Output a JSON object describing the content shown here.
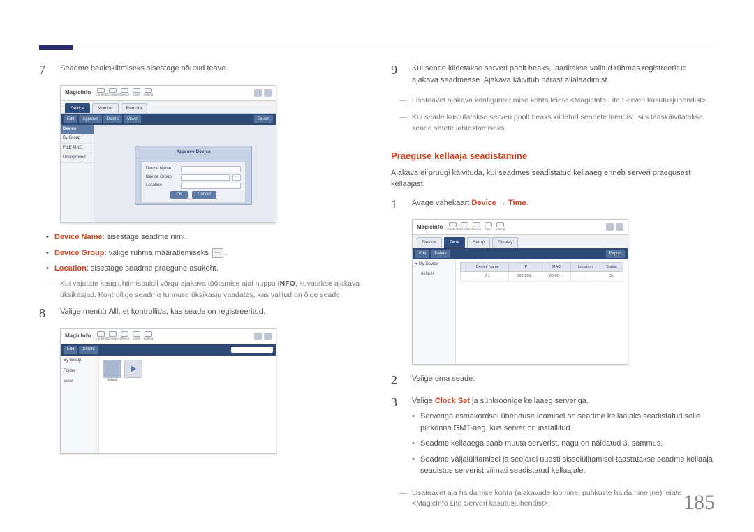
{
  "page_number": "185",
  "left": {
    "step7": {
      "num": "7",
      "text": "Seadme heakskiitmiseks sisestage nõutud teave.",
      "bullet1_label": "Device Name",
      "bullet1_text": ": sisestage seadme nimi.",
      "bullet2_label": "Device Group",
      "bullet2_text": ": valige rühma määratlemiseks",
      "bullet2_after": ".",
      "bullet3_label": "Location",
      "bullet3_text": ": sisestage seadme praegune asukoht.",
      "dash1_a": "Kui vajutate kaugjuhtimispuldil võrgu ajakava töötamise ajal nuppu ",
      "dash1_info": "INFO",
      "dash1_b": ", kuvatakse ajakava üksikasjad. Kontrollige seadme tunnuse üksikasju vaadates, kas valitud on õige seade."
    },
    "step8": {
      "num": "8",
      "text_a": "Valige menüü ",
      "text_all": "All",
      "text_b": ", et kontrollida, kas seade on registreeritud."
    },
    "ss_common": {
      "logo": "MagicInfo",
      "icons": [
        "Content",
        "Schedule",
        "Device",
        "User",
        "Setting"
      ],
      "toolbar_btns": [
        "Edit",
        "Approve",
        "Delete",
        "Move",
        "Export"
      ]
    },
    "ss1": {
      "tabs": [
        "Device",
        "Monitor",
        "Remote"
      ],
      "side": [
        "Device",
        "By Group",
        "FILE MNG",
        "Unapproved"
      ],
      "approve_title": "Approve Device",
      "rows": [
        "Device Name",
        "Device Group",
        "Location"
      ],
      "ok": "OK",
      "cancel": "Cancel"
    },
    "ss2": {
      "side": [
        "By Group",
        "Folder",
        "View"
      ],
      "tile_label": "default"
    }
  },
  "right": {
    "step9": {
      "num": "9",
      "p1": "Kui seade kiidetakse serveri poolt heaks, laaditakse valitud rühmas registreeritud ajakava seadmesse. Ajakava käivitub pärast allalaadimist.",
      "d1": "Lisateavet ajakava konfigureerimise kohta leiate <MagicInfo Lite Serveri kasutusjuhendist>.",
      "d2": "Kui seade kustutatakse serveri poolt heaks kiidetud seadete loendist, siis taaskäivitatakse seade sätete lähtestamiseks."
    },
    "section_title": "Praeguse kellaaja seadistamine",
    "section_lead": "Ajakava ei pruugi käivituda, kui seadmes seadistatud kellaaeg erineb serveri praegusest kellaajast.",
    "step1": {
      "num": "1",
      "a": "Avage vahekaart ",
      "b": "Device",
      "arrow": " → ",
      "c": "Time",
      "dot": "."
    },
    "ss3": {
      "tabs": [
        "Device",
        "Time",
        "Setup",
        "Display"
      ],
      "tree_root": "My Device",
      "tree_child": "default",
      "th": [
        "",
        "Device Name",
        "IP",
        "MAC",
        "Location",
        "Status"
      ],
      "row": [
        "",
        "A1",
        "192.168...",
        "00-00-...",
        "-",
        "On"
      ]
    },
    "step2": {
      "num": "2",
      "text": "Valige oma seade."
    },
    "step3": {
      "num": "3",
      "a": "Valige ",
      "b": "Clock Set",
      "c": " ja sünkroonige kellaaeg serveriga.",
      "bul1": "Serveriga esmakordsel ühenduse loomisel on seadme kellaajaks seadistatud selle piirkonna GMT-aeg, kus server on installitud.",
      "bul2": "Seadme kellaaega saab muuta serverist, nagu on näidatud 3. sammus.",
      "bul3": "Seadme väljalülitamisel ja seejärel uuesti sisselülitamisel taastatakse seadme kellaaja seadistus serverist viimati seadistatud kellaajale.",
      "dash": "Lisateavet aja haldamise kohta (ajakavade loomine, puhkuste haldamine jne) leiate <MagicInfo Lite Serveri kasutusjuhendist>."
    }
  }
}
